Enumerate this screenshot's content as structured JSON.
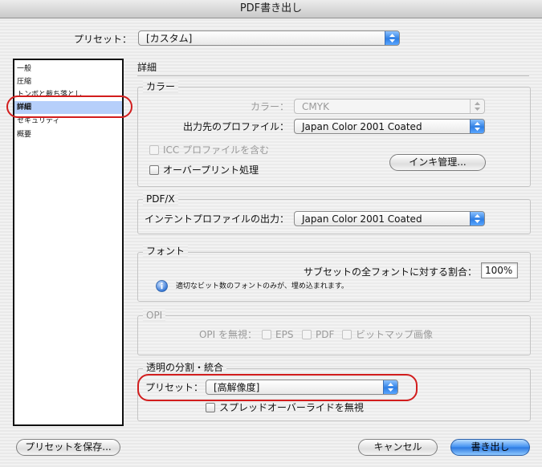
{
  "window": {
    "title": "PDF書き出し"
  },
  "preset": {
    "label": "プリセット：",
    "value": "[カスタム]"
  },
  "sidebar": {
    "items": [
      {
        "label": "一般"
      },
      {
        "label": "圧縮"
      },
      {
        "label": "トンボと裁ち落とし"
      },
      {
        "label": "詳細",
        "selected": true
      },
      {
        "label": "セキュリティ"
      },
      {
        "label": "概要"
      }
    ]
  },
  "main": {
    "section_title": "詳細",
    "color": {
      "title": "カラー",
      "color_label": "カラー：",
      "color_value": "CMYK",
      "dest_profile_label": "出力先のプロファイル：",
      "dest_profile_value": "Japan Color 2001 Coated",
      "icc_include_label": "ICC プロファイルを含む",
      "overprint_label": "オーバープリント処理",
      "ink_manager_label": "インキ管理..."
    },
    "pdfx": {
      "title": "PDF/X",
      "intent_label": "インテントプロファイルの出力：",
      "intent_value": "Japan Color 2001 Coated"
    },
    "font": {
      "title": "フォント",
      "subset_label": "サブセットの全フォントに対する割合：",
      "subset_value": "100%",
      "info_text": "適切なビット数のフォントのみが、埋め込まれます。"
    },
    "opi": {
      "title": "OPI",
      "ignore_label": "OPI を無視：",
      "eps_label": "EPS",
      "pdf_label": "PDF",
      "bitmap_label": "ビットマップ画像"
    },
    "transparency": {
      "title": "透明の分割・統合",
      "preset_label": "プリセット：",
      "preset_value": "[高解像度]",
      "ignore_spread_label": "スプレッドオーバーライドを無視"
    }
  },
  "footer": {
    "save_preset_label": "プリセットを保存...",
    "cancel_label": "キャンセル",
    "export_label": "書き出し"
  },
  "colors": {
    "highlight": "#d21d1d",
    "selection": "#b6cffa",
    "aqua_blue": "#2f7fe4"
  }
}
